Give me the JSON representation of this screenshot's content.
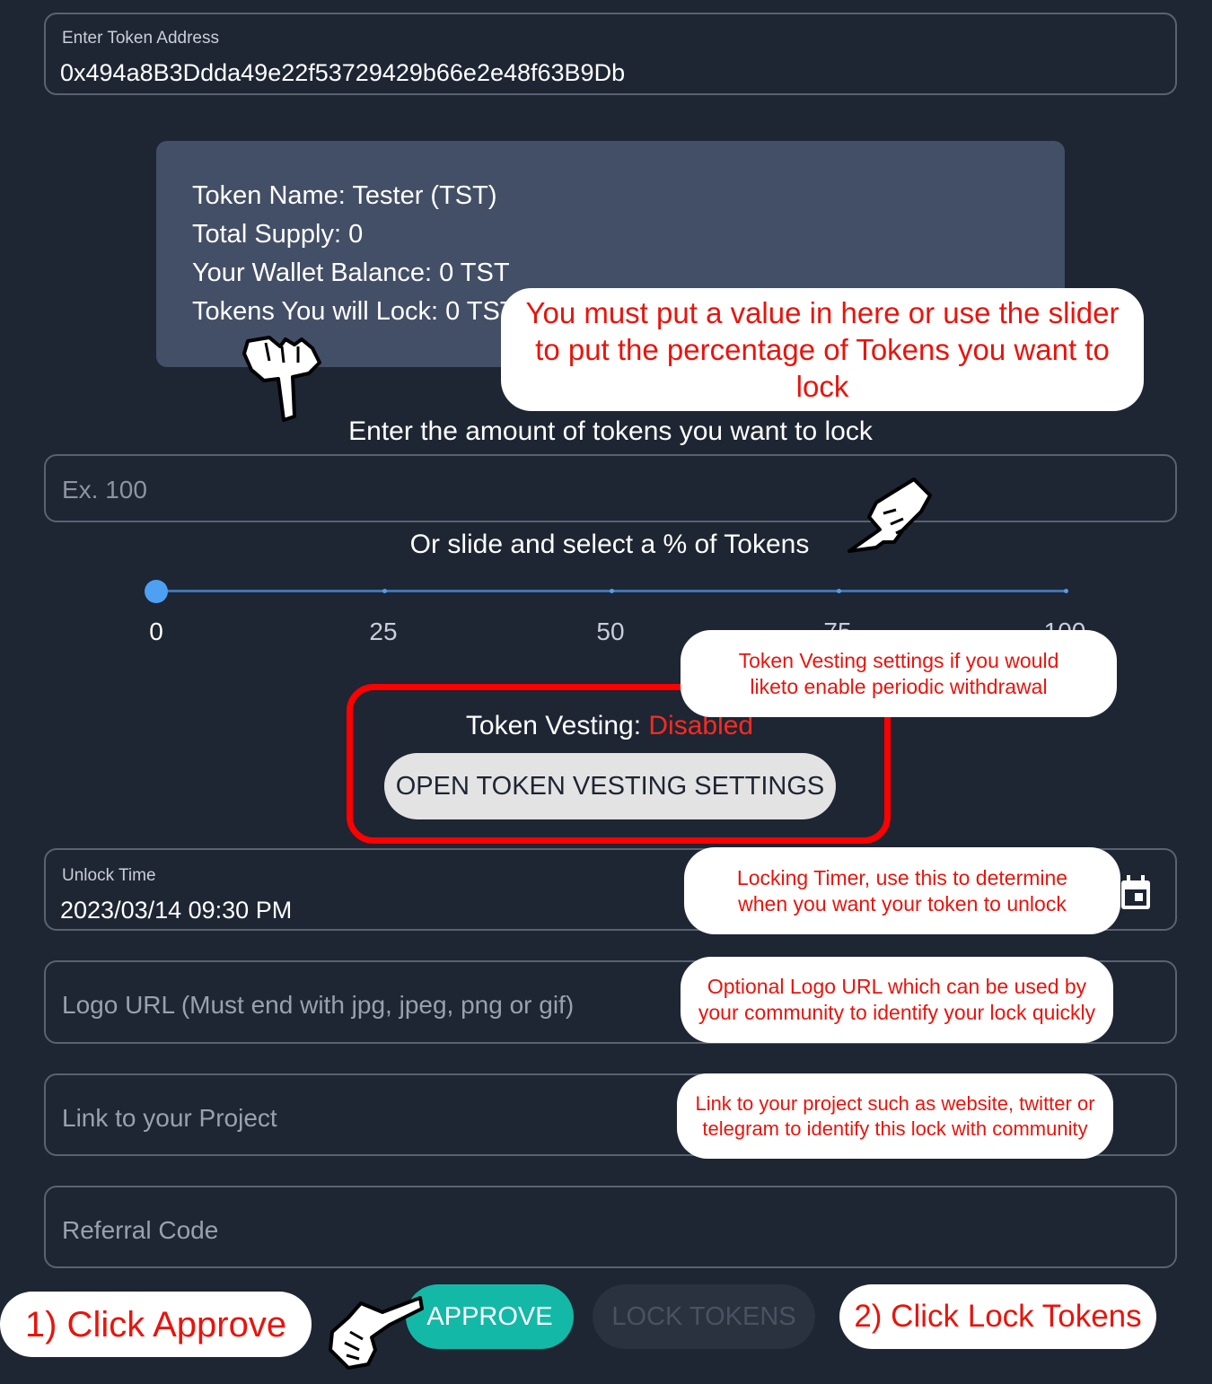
{
  "token_address": {
    "label": "Enter Token Address",
    "value": "0x494a8B3Ddda49e22f53729429b66e2e48f63B9Db"
  },
  "token_info": {
    "name": "Token Name: Tester (TST)",
    "total_supply": "Total Supply: 0",
    "wallet_balance": "Your Wallet Balance: 0 TST",
    "tokens_lock": "Tokens You will Lock: 0 TST"
  },
  "amount": {
    "heading": "Enter the amount of tokens you want to lock",
    "placeholder": "Ex. 100"
  },
  "slider": {
    "heading": "Or slide and select a % of Tokens",
    "value_percent": 0,
    "marks": [
      "0",
      "25",
      "50",
      "75",
      "100"
    ]
  },
  "vesting": {
    "label": "Token Vesting:",
    "status": "Disabled",
    "button": "OPEN TOKEN VESTING SETTINGS"
  },
  "unlock_time": {
    "label": "Unlock Time",
    "value": "2023/03/14 09:30 PM",
    "icon": "calendar-icon"
  },
  "logo_url": {
    "placeholder": "Logo URL (Must end with jpg, jpeg, png or gif)"
  },
  "project_link": {
    "placeholder": "Link to your Project"
  },
  "referral": {
    "placeholder": "Referral Code"
  },
  "actions": {
    "approve": "APPROVE",
    "lock": "LOCK TOKENS"
  },
  "callouts": {
    "amount_hint": "You must put a value in here or use the slider to put the percentage of Tokens you want to lock",
    "vesting_hint": "Token Vesting settings if you would liketo enable periodic withdrawal",
    "timer_hint": "Locking Timer, use this to determine when you want your token to unlock",
    "logo_hint": "Optional Logo URL which can be used by your community to identify your lock quickly",
    "link_hint": "Link to your project such as website, twitter or telegram to identify this lock with community",
    "step1": "1) Click Approve",
    "step2": "2) Click Lock Tokens"
  },
  "colors": {
    "background": "#1e2533",
    "info_box": "#434f66",
    "accent_blue": "#4da0f2",
    "approve_green": "#14b8a6",
    "annotation_red": "#e8140c"
  }
}
